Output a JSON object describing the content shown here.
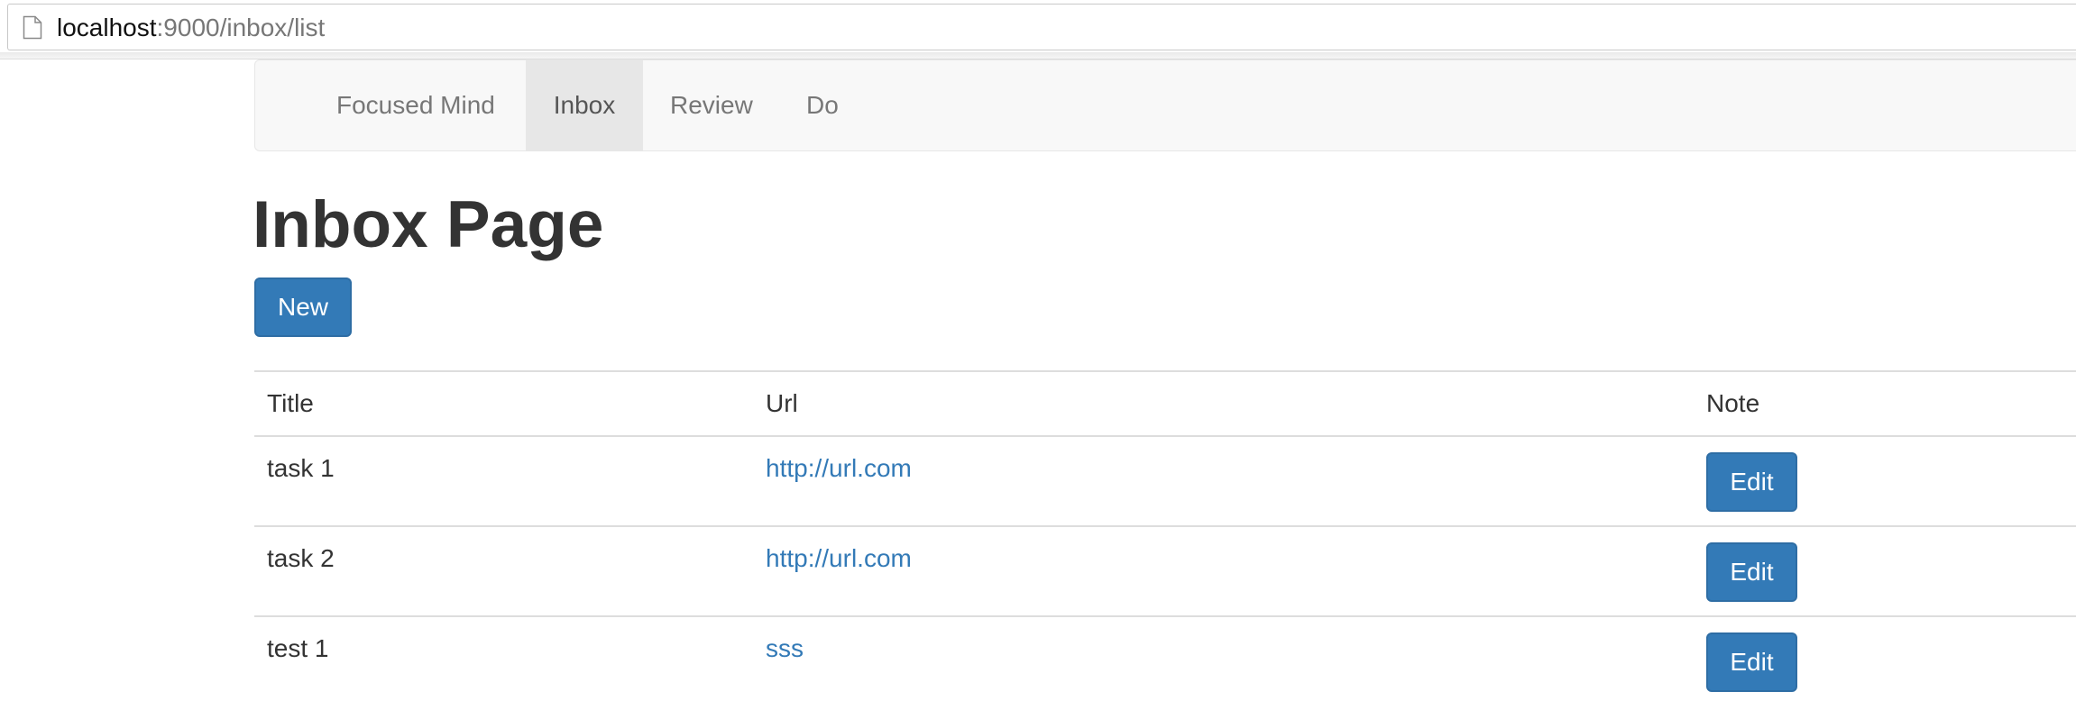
{
  "browser": {
    "url_host": "localhost",
    "url_rest": ":9000/inbox/list",
    "page_icon": "document-icon"
  },
  "navbar": {
    "brand": "Focused Mind",
    "items": [
      {
        "label": "Inbox",
        "active": true
      },
      {
        "label": "Review",
        "active": false
      },
      {
        "label": "Do",
        "active": false
      }
    ]
  },
  "page": {
    "title": "Inbox Page",
    "new_button": "New"
  },
  "table": {
    "headers": [
      "Title",
      "Url",
      "Note"
    ],
    "rows": [
      {
        "title": "task 1",
        "url": "http://url.com",
        "action": "Edit"
      },
      {
        "title": "task 2",
        "url": "http://url.com",
        "action": "Edit"
      },
      {
        "title": "test 1",
        "url": "sss",
        "action": "Edit"
      }
    ]
  },
  "colors": {
    "primary": "#337ab7",
    "navbar_bg": "#f8f8f8",
    "active_tab_bg": "#e7e7e7",
    "text": "#333333"
  }
}
